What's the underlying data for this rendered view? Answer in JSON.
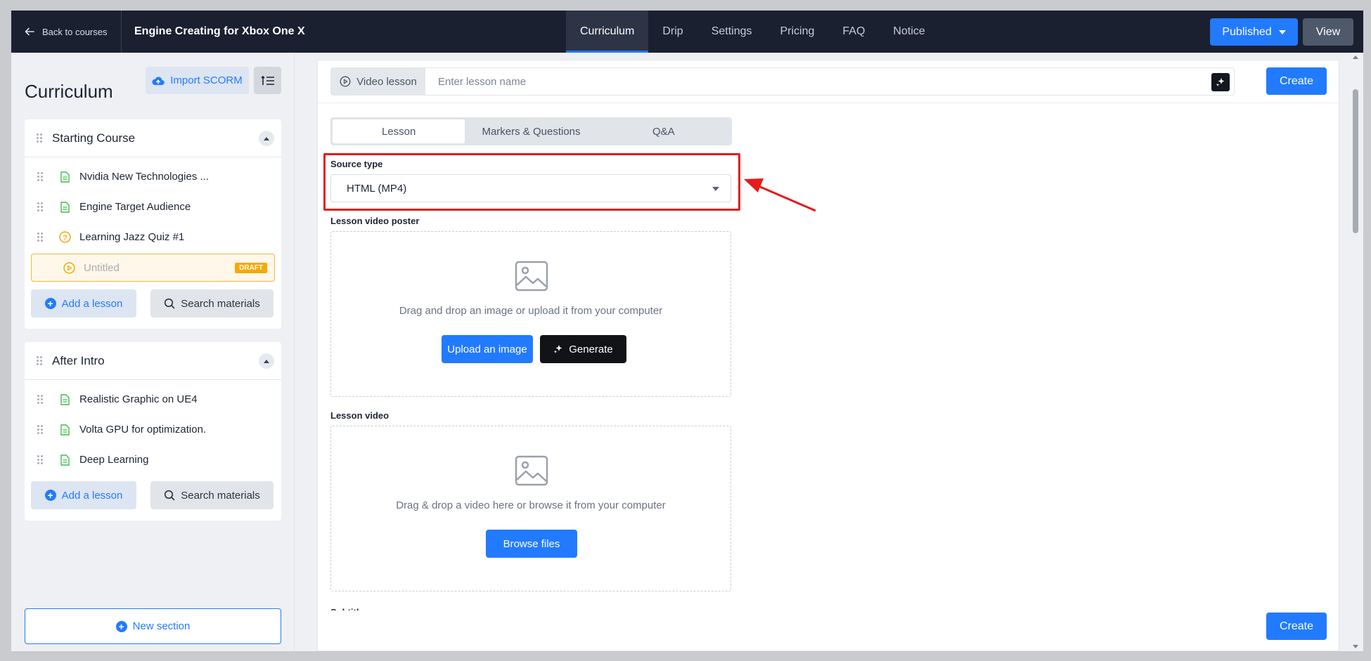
{
  "topbar": {
    "back_label": "Back to courses",
    "course_title": "Engine Creating for Xbox One X",
    "tabs": [
      "Curriculum",
      "Drip",
      "Settings",
      "Pricing",
      "FAQ",
      "Notice"
    ],
    "active_tab": "Curriculum",
    "published_label": "Published",
    "view_label": "View"
  },
  "sidebar": {
    "title": "Curriculum",
    "import_label": "Import SCORM",
    "sections": [
      {
        "title": "Starting Course",
        "lessons": [
          {
            "title": "Nvidia New Technologies ...",
            "icon": "document-icon"
          },
          {
            "title": "Engine Target Audience",
            "icon": "document-icon"
          },
          {
            "title": "Learning Jazz Quiz #1",
            "icon": "quiz-icon"
          },
          {
            "title": "Untitled",
            "icon": "play-icon",
            "badge": "DRAFT"
          }
        ]
      },
      {
        "title": "After Intro",
        "lessons": [
          {
            "title": "Realistic Graphic on UE4",
            "icon": "document-icon"
          },
          {
            "title": "Volta GPU for optimization.",
            "icon": "document-icon"
          },
          {
            "title": "Deep Learning",
            "icon": "document-icon"
          }
        ]
      }
    ],
    "add_lesson_label": "Add a lesson",
    "search_materials_label": "Search materials",
    "new_section_label": "New section"
  },
  "main": {
    "lesson_type": "Video lesson",
    "lesson_name_placeholder": "Enter lesson name",
    "create_label": "Create",
    "seg_tabs": [
      "Lesson",
      "Markers & Questions",
      "Q&A"
    ],
    "active_seg": "Lesson",
    "source_type_label": "Source type",
    "source_type_value": "HTML (MP4)",
    "poster_label": "Lesson video poster",
    "poster_text": "Drag and drop an image or upload it from your computer",
    "upload_label": "Upload an image",
    "generate_label": "Generate",
    "video_label": "Lesson video",
    "video_text": "Drag & drop a video here or browse it from your computer",
    "browse_label": "Browse files",
    "subtitles_label": "Subtitles"
  },
  "colors": {
    "accent": "#227aff",
    "topbar": "#1a2030",
    "highlight": "#e51b1b",
    "draft": "#f7a800"
  }
}
